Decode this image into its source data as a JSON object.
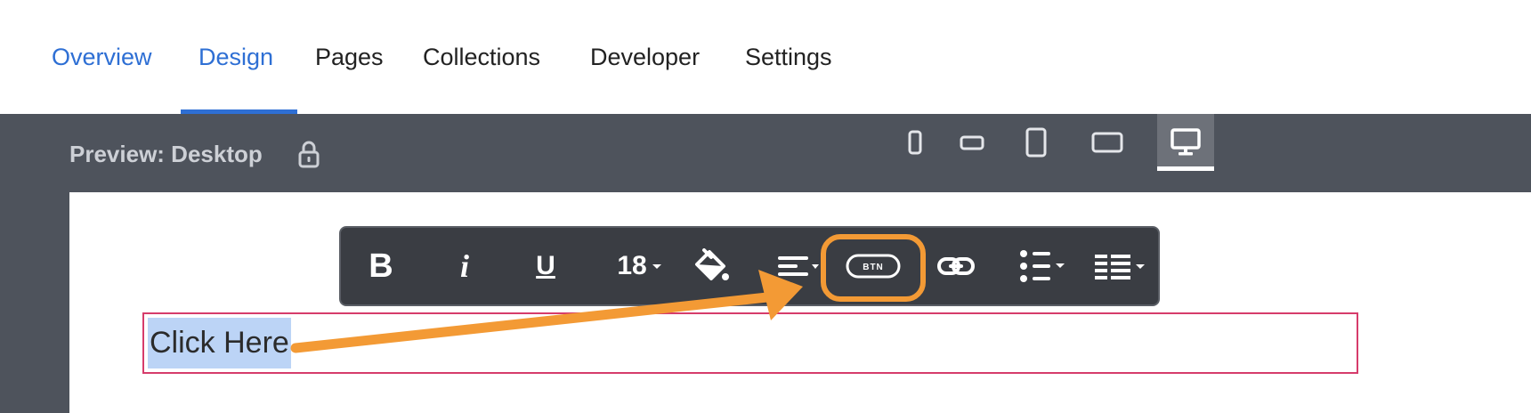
{
  "nav": {
    "tabs": [
      {
        "label": "Overview",
        "active": false
      },
      {
        "label": "Design",
        "active": true
      },
      {
        "label": "Pages",
        "active": false
      },
      {
        "label": "Collections",
        "active": false
      },
      {
        "label": "Developer",
        "active": false
      },
      {
        "label": "Settings",
        "active": false
      }
    ]
  },
  "preview": {
    "label": "Preview: Desktop",
    "devices": [
      "mobile-portrait-icon",
      "mobile-landscape-icon",
      "tablet-portrait-icon",
      "tablet-landscape-icon",
      "desktop-icon"
    ],
    "active_device": "desktop-icon"
  },
  "toolbar": {
    "bold_label": "B",
    "italic_label": "i",
    "underline_label": "U",
    "font_size": "18",
    "button_badge": "BTN"
  },
  "editor": {
    "selected_text": "Click Here"
  },
  "colors": {
    "accent": "#2e6fd4",
    "highlight": "#f39a35",
    "selection": "#bcd4f6",
    "textbox_border": "#d63c6b"
  }
}
